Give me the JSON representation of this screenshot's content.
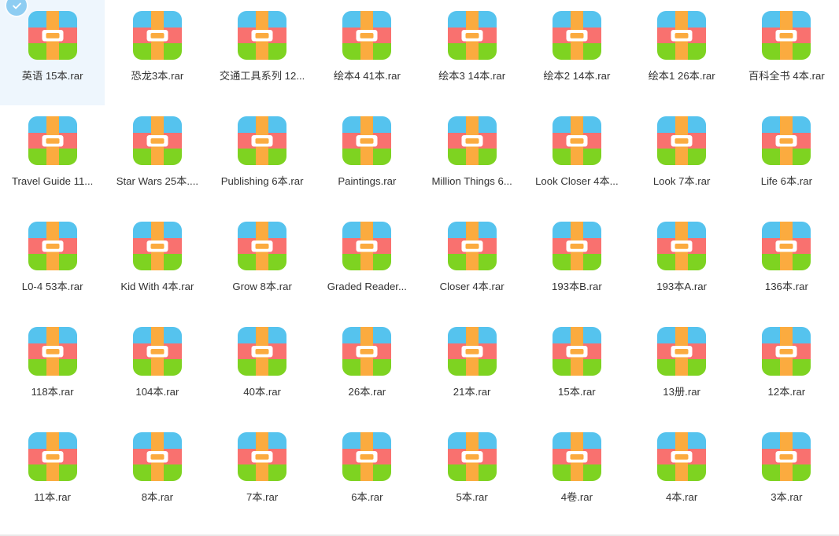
{
  "window": {
    "title": "File Grid",
    "view_mode": "icons"
  },
  "selection": {
    "selected_index": 0,
    "badge_icon": "check-circle-icon",
    "highlight_color": "#eef6fd",
    "badge_color": "#8ecdf2"
  },
  "icon": {
    "name": "rar-archive-icon",
    "colors": {
      "blue": "#55c3ee",
      "red": "#f9716f",
      "green": "#7ed321",
      "orange": "#fbab3f",
      "buckle": "#ffffff"
    }
  },
  "files": [
    {
      "name": "英语 15本.rar",
      "icon": "rar-archive-icon",
      "selected": true
    },
    {
      "name": "恐龙3本.rar",
      "icon": "rar-archive-icon",
      "selected": false
    },
    {
      "name": "交通工具系列 12...",
      "icon": "rar-archive-icon",
      "selected": false
    },
    {
      "name": "绘本4 41本.rar",
      "icon": "rar-archive-icon",
      "selected": false
    },
    {
      "name": "绘本3 14本.rar",
      "icon": "rar-archive-icon",
      "selected": false
    },
    {
      "name": "绘本2 14本.rar",
      "icon": "rar-archive-icon",
      "selected": false
    },
    {
      "name": "绘本1 26本.rar",
      "icon": "rar-archive-icon",
      "selected": false
    },
    {
      "name": "百科全书 4本.rar",
      "icon": "rar-archive-icon",
      "selected": false
    },
    {
      "name": "Travel Guide 11...",
      "icon": "rar-archive-icon",
      "selected": false
    },
    {
      "name": "Star Wars 25本....",
      "icon": "rar-archive-icon",
      "selected": false
    },
    {
      "name": "Publishing 6本.rar",
      "icon": "rar-archive-icon",
      "selected": false
    },
    {
      "name": "Paintings.rar",
      "icon": "rar-archive-icon",
      "selected": false
    },
    {
      "name": "Million Things 6...",
      "icon": "rar-archive-icon",
      "selected": false
    },
    {
      "name": "Look Closer 4本...",
      "icon": "rar-archive-icon",
      "selected": false
    },
    {
      "name": "Look 7本.rar",
      "icon": "rar-archive-icon",
      "selected": false
    },
    {
      "name": "Life 6本.rar",
      "icon": "rar-archive-icon",
      "selected": false
    },
    {
      "name": "L0-4 53本.rar",
      "icon": "rar-archive-icon",
      "selected": false
    },
    {
      "name": "Kid With 4本.rar",
      "icon": "rar-archive-icon",
      "selected": false
    },
    {
      "name": "Grow 8本.rar",
      "icon": "rar-archive-icon",
      "selected": false
    },
    {
      "name": "Graded Reader...",
      "icon": "rar-archive-icon",
      "selected": false
    },
    {
      "name": "Closer 4本.rar",
      "icon": "rar-archive-icon",
      "selected": false
    },
    {
      "name": "193本B.rar",
      "icon": "rar-archive-icon",
      "selected": false
    },
    {
      "name": "193本A.rar",
      "icon": "rar-archive-icon",
      "selected": false
    },
    {
      "name": "136本.rar",
      "icon": "rar-archive-icon",
      "selected": false
    },
    {
      "name": "118本.rar",
      "icon": "rar-archive-icon",
      "selected": false
    },
    {
      "name": "104本.rar",
      "icon": "rar-archive-icon",
      "selected": false
    },
    {
      "name": "40本.rar",
      "icon": "rar-archive-icon",
      "selected": false
    },
    {
      "name": "26本.rar",
      "icon": "rar-archive-icon",
      "selected": false
    },
    {
      "name": "21本.rar",
      "icon": "rar-archive-icon",
      "selected": false
    },
    {
      "name": "15本.rar",
      "icon": "rar-archive-icon",
      "selected": false
    },
    {
      "name": "13册.rar",
      "icon": "rar-archive-icon",
      "selected": false
    },
    {
      "name": "12本.rar",
      "icon": "rar-archive-icon",
      "selected": false
    },
    {
      "name": "11本.rar",
      "icon": "rar-archive-icon",
      "selected": false
    },
    {
      "name": "8本.rar",
      "icon": "rar-archive-icon",
      "selected": false
    },
    {
      "name": "7本.rar",
      "icon": "rar-archive-icon",
      "selected": false
    },
    {
      "name": "6本.rar",
      "icon": "rar-archive-icon",
      "selected": false
    },
    {
      "name": "5本.rar",
      "icon": "rar-archive-icon",
      "selected": false
    },
    {
      "name": "4卷.rar",
      "icon": "rar-archive-icon",
      "selected": false
    },
    {
      "name": "4本.rar",
      "icon": "rar-archive-icon",
      "selected": false
    },
    {
      "name": "3本.rar",
      "icon": "rar-archive-icon",
      "selected": false
    }
  ]
}
